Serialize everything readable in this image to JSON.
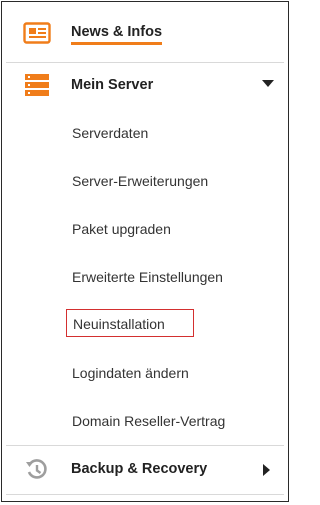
{
  "menu": {
    "news": {
      "label": "News & Infos",
      "icon": "newspaper-icon"
    },
    "server": {
      "label": "Mein Server",
      "icon": "server-icon",
      "expanded": true
    },
    "server_items": [
      {
        "label": "Serverdaten"
      },
      {
        "label": "Server-Erweiterungen"
      },
      {
        "label": "Paket upgraden"
      },
      {
        "label": "Erweiterte Einstellungen"
      },
      {
        "label": "Neuinstallation",
        "highlighted": true
      },
      {
        "label": "Logindaten ändern"
      },
      {
        "label": "Domain Reseller-Vertrag"
      }
    ],
    "backup": {
      "label": "Backup & Recovery",
      "icon": "history-icon",
      "expanded": false
    }
  },
  "colors": {
    "accent": "#f07d1a",
    "highlight_border": "#d32f2f",
    "icon_gray": "#9e9e9e"
  }
}
